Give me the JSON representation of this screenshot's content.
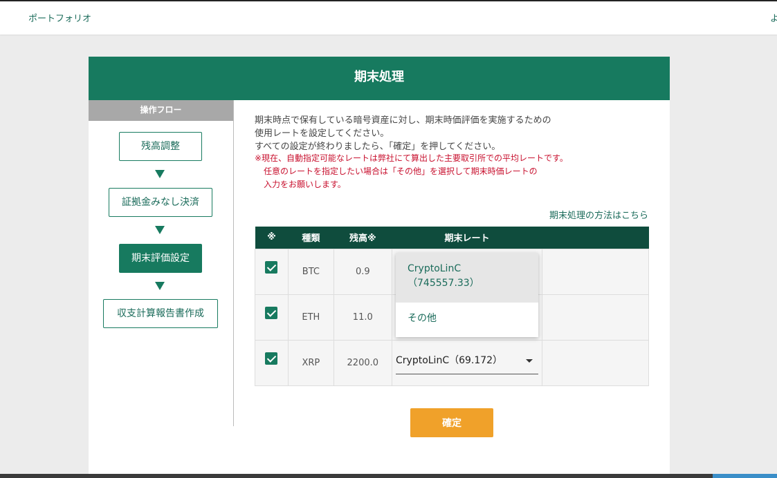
{
  "topbar": {
    "nav_label": "ポートフォリオ",
    "right_label": "よ"
  },
  "panel": {
    "title": "期末処理"
  },
  "sidebar": {
    "title": "操作フロー",
    "steps": [
      {
        "label": "残高調整",
        "active": false
      },
      {
        "label": "証拠金みなし決済",
        "active": false
      },
      {
        "label": "期末評価設定",
        "active": true
      },
      {
        "label": "収支計算報告書作成",
        "active": false
      }
    ]
  },
  "main": {
    "description": [
      "期末時点で保有している暗号資産に対し、期末時価評価を実施するための",
      "使用レートを設定してください。",
      "すべての設定が終わりましたら、「確定」を押してください。"
    ],
    "notes": [
      "※現在、自動指定可能なレートは弊社にて算出した主要取引所での平均レートです。",
      "任意のレートを指定したい場合は「その他」を選択して期末時価レートの",
      "入力をお願いします。"
    ],
    "howto_link": "期末処理の方法はこちら"
  },
  "table": {
    "headers": [
      "※",
      "種類",
      "残高※",
      "期末レート"
    ],
    "rows": [
      {
        "checked": true,
        "type": "BTC",
        "balance": "0.9"
      },
      {
        "checked": true,
        "type": "ETH",
        "balance": "11.0"
      },
      {
        "checked": true,
        "type": "XRP",
        "balance": "2200.0",
        "rate": "CryptoLinC（69.172）"
      }
    ]
  },
  "dropdown": {
    "options": [
      {
        "line1": "CryptoLinC",
        "line2": "（745557.33）",
        "selected": true
      },
      {
        "line1": "その他",
        "selected": false
      }
    ]
  },
  "confirm_label": "確定",
  "colors": {
    "primary": "#177a5f",
    "header_dark": "#0f4c3d",
    "accent": "#f0a12a",
    "note": "#c8102e"
  }
}
